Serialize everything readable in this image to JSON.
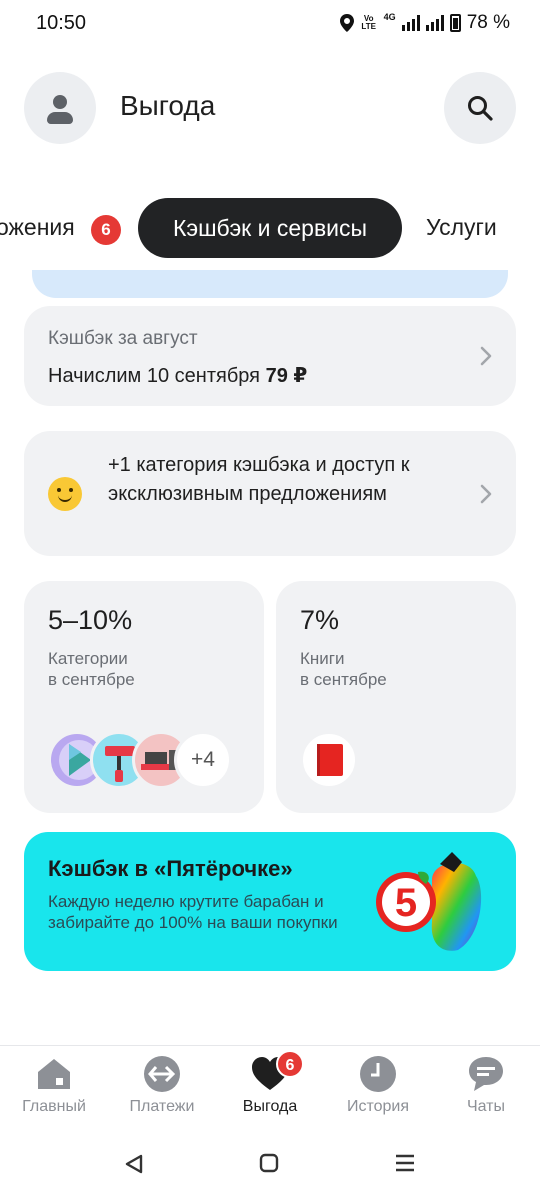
{
  "status_bar": {
    "time": "10:50",
    "volte": "Vo LTE",
    "network": "4G",
    "battery": "78 %"
  },
  "header": {
    "title": "Выгода",
    "avatar_icon": "user-icon",
    "search_icon": "search-icon"
  },
  "tabs": {
    "left_label": "ожения",
    "left_badge": "6",
    "active_label": "Кэшбэк и сервисы",
    "right_label": "Услуги"
  },
  "cashback_month": {
    "label": "Кэшбэк за август",
    "text": "Начислим 10 сентября",
    "amount": "79 ₽"
  },
  "promo": {
    "text": "+1 категория кэшбэка и доступ к эксклюзивным предложениям",
    "icon": "smile-emoji-icon"
  },
  "tiles": [
    {
      "percent": "5–10%",
      "subtitle": "Категории\nв сентябре",
      "more": "+4"
    },
    {
      "percent": "7%",
      "subtitle": " Книги\nв сентябре"
    }
  ],
  "pyaterochka": {
    "title": "Кэшбэк в «Пятёрочке»",
    "text": "Каждую неделю крутите барабан и забирайте до 100% на ваши покупки",
    "logo_digit": "5",
    "bg_color": "#19e5ec"
  },
  "bottom_nav": {
    "items": [
      {
        "label": "Главный",
        "icon": "home-icon"
      },
      {
        "label": "Платежи",
        "icon": "transfer-icon"
      },
      {
        "label": "Выгода",
        "icon": "heart-icon",
        "badge": "6",
        "active": true
      },
      {
        "label": "История",
        "icon": "clock-icon"
      },
      {
        "label": "Чаты",
        "icon": "chat-icon"
      }
    ]
  },
  "colors": {
    "accent_badge": "#e53935",
    "active_tab": "#222325",
    "card_bg": "#f1f2f4"
  }
}
